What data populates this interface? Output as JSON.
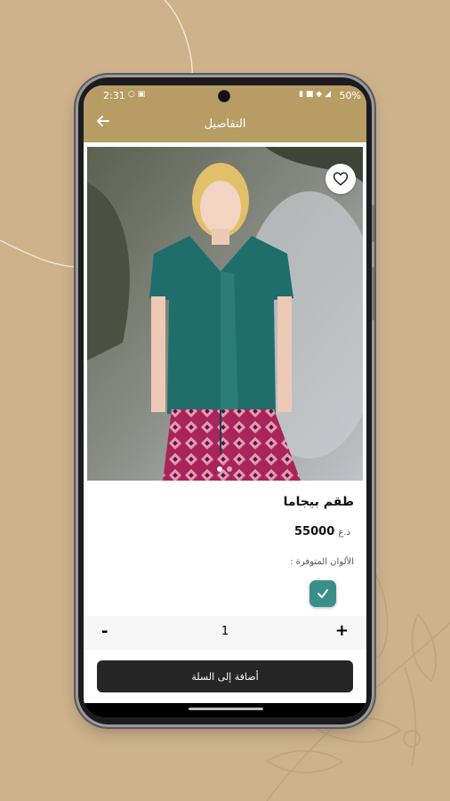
{
  "status_bar": {
    "time": "2:31",
    "left_icons": "○ ▣",
    "right_icons": "▮ ■ ◆ ◢",
    "battery": "50%"
  },
  "app_bar": {
    "title": "التفاصيل",
    "back_icon": "arrow-left-icon"
  },
  "product": {
    "name": "طقم بيجاما",
    "price": "55000",
    "currency": "د.ع",
    "image_count": 2,
    "active_image": 1,
    "favorite_icon": "heart-outline-icon"
  },
  "colors": {
    "label": "الألوان المتوفرة :",
    "selected_color": "#3a8e8a"
  },
  "quantity": {
    "minus": "-",
    "value": "1",
    "plus": "+"
  },
  "cart": {
    "add_label": "أضافة إلى السلة"
  },
  "theme": {
    "background": "#cdb28b",
    "header": "#b79d64",
    "button": "#262626"
  }
}
